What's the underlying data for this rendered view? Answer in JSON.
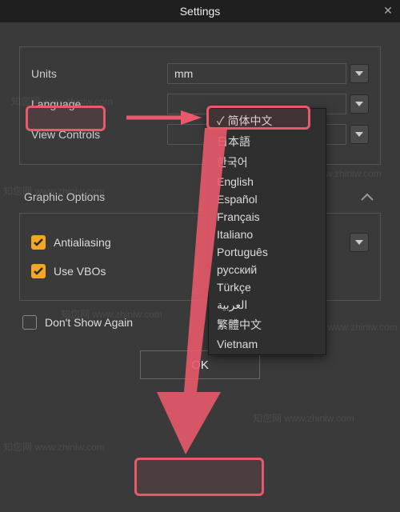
{
  "title": "Settings",
  "section1": {
    "units_label": "Units",
    "units_value": "mm",
    "language_label": "Language",
    "language_value": "简体中文",
    "view_label": "View Controls"
  },
  "section2_title": "Graphic Options",
  "checks": {
    "aa": "Antialiasing",
    "vbo": "Use VBOs"
  },
  "dont_show": "Don't Show Again",
  "ok": "OK",
  "lang_options": [
    "简体中文",
    "日本語",
    "한국어",
    "English",
    "Español",
    "Français",
    "Italiano",
    "Português",
    "русский",
    "Türkçe",
    "العربية",
    "繁體中文",
    "Vietnam"
  ],
  "watermark": "知您网 www.zhiniw.com"
}
